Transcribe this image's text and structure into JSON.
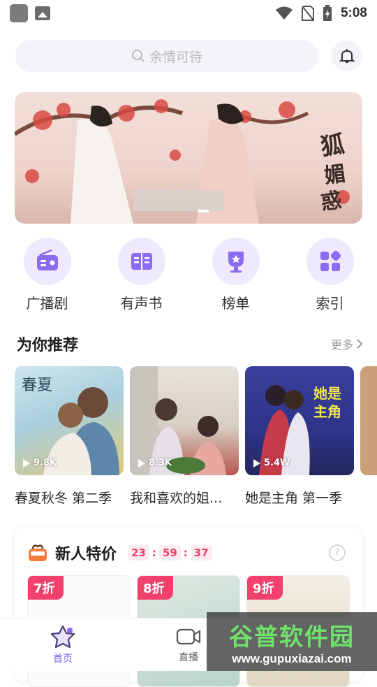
{
  "status_bar": {
    "time": "5:08"
  },
  "search": {
    "placeholder": "余情可待"
  },
  "quick_nav": [
    {
      "label": "广播剧",
      "icon": "radio-icon"
    },
    {
      "label": "有声书",
      "icon": "book-icon"
    },
    {
      "label": "榜单",
      "icon": "trophy-icon"
    },
    {
      "label": "索引",
      "icon": "category-icon"
    }
  ],
  "recommend": {
    "title": "为你推荐",
    "more_label": "更多",
    "items": [
      {
        "title": "春夏秋冬 第二季",
        "plays": "9.8K"
      },
      {
        "title": "我和喜欢的姐...",
        "plays": "8.3K"
      },
      {
        "title": "她是主角 第一季",
        "plays": "5.4W"
      }
    ]
  },
  "new_user": {
    "title": "新人特价",
    "timer": {
      "h": "23",
      "m": "59",
      "s": "37"
    },
    "help": "?",
    "deals": [
      {
        "discount": "7折"
      },
      {
        "discount": "8折"
      },
      {
        "discount": "9折"
      }
    ]
  },
  "tabs": [
    {
      "label": "首页",
      "active": true
    },
    {
      "label": "直播",
      "active": false
    }
  ],
  "watermark": {
    "name": "谷普软件园",
    "url": "www.gupuxiazai.com"
  },
  "colors": {
    "accent": "#8a6cf0",
    "sale": "#f0406b",
    "tab_active": "#7b5ce8"
  }
}
